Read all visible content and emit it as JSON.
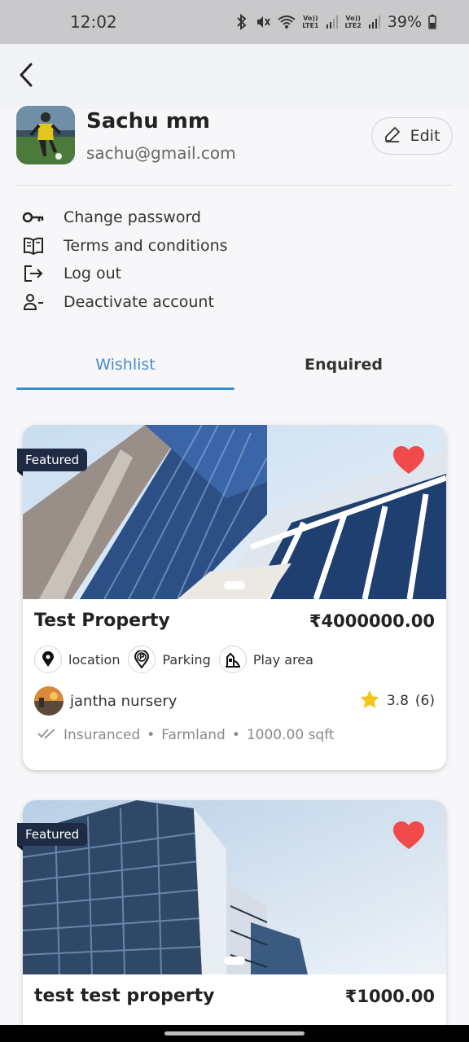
{
  "status_bar": {
    "time": "12:02",
    "battery": "39%",
    "sim1": "LTE1",
    "sim2": "LTE2",
    "volte": "Vo))"
  },
  "header": {
    "back_icon": "chevron-left-icon"
  },
  "profile": {
    "name": "Sachu mm",
    "email": "sachu@gmail.com",
    "edit_label": "Edit"
  },
  "menu": [
    {
      "label": "Change password",
      "icon": "key-icon"
    },
    {
      "label": "Terms and conditions",
      "icon": "book-icon"
    },
    {
      "label": "Log out",
      "icon": "logout-icon"
    },
    {
      "label": "Deactivate account",
      "icon": "user-minus-icon"
    }
  ],
  "tabs": [
    {
      "label": "Wishlist",
      "active": true
    },
    {
      "label": "Enquired",
      "active": false
    }
  ],
  "properties": [
    {
      "badge": "Featured",
      "title": "Test Property",
      "price": "₹4000000.00",
      "amenities": [
        "location",
        "Parking",
        "Play area"
      ],
      "owner": "jantha nursery",
      "rating": "3.8",
      "reviews": "(6)",
      "meta": [
        "Insuranced",
        "Farmland",
        "1000.00 sqft"
      ]
    },
    {
      "badge": "Featured",
      "title": "test test property",
      "price": "₹1000.00"
    }
  ],
  "colors": {
    "accent": "#3a8fd0",
    "heart": "#f04a4a",
    "badge": "#1f2a44",
    "star": "#f5c518"
  }
}
